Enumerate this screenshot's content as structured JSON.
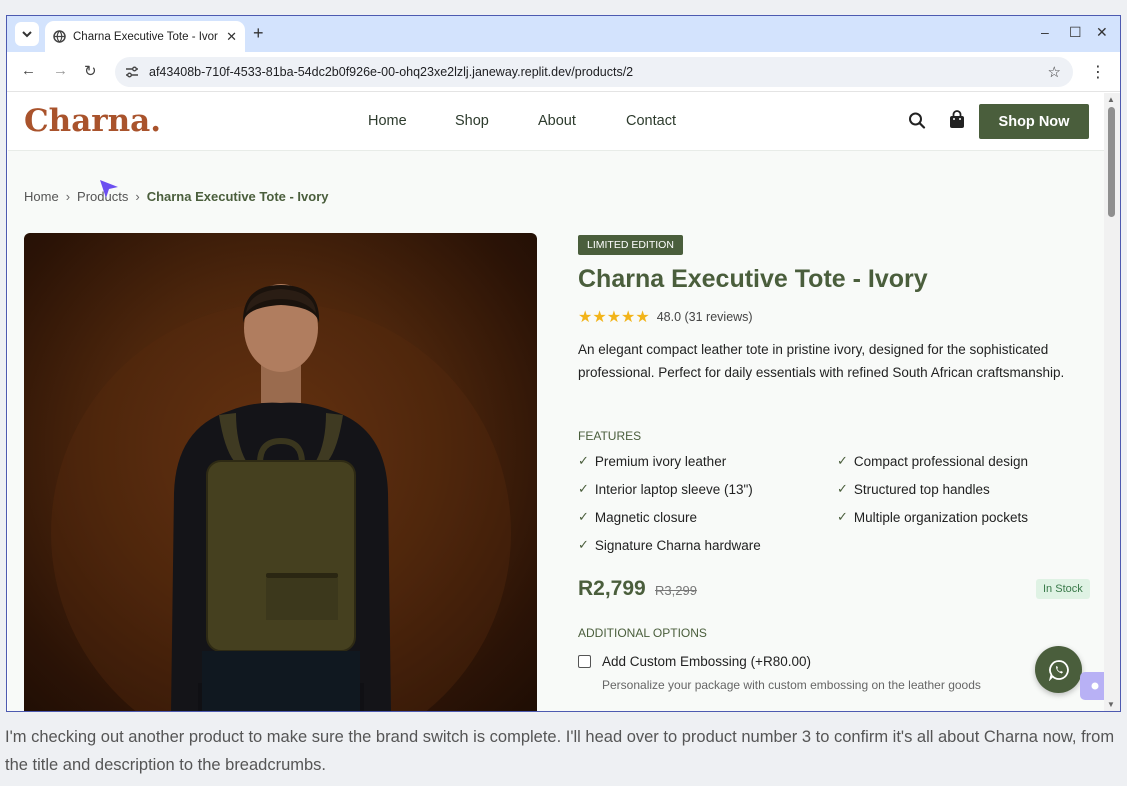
{
  "browser": {
    "tab_title": "Charna Executive Tote - Ivory",
    "tab_close": "✕",
    "new_tab": "+",
    "url": "af43408b-710f-4533-81ba-54dc2b0f926e-00-ohq23xe2lzlj.janeway.replit.dev/products/2",
    "window_controls": {
      "minimize": "–",
      "maximize": "☐",
      "close": "✕"
    }
  },
  "site": {
    "logo": "Charna.",
    "nav": [
      "Home",
      "Shop",
      "About",
      "Contact"
    ],
    "cta": "Shop Now",
    "icons": [
      "search-icon",
      "bag-icon"
    ]
  },
  "breadcrumb": [
    "Home",
    "Products",
    "Charna Executive Tote - Ivory"
  ],
  "product": {
    "badge": "LIMITED EDITION",
    "title": "Charna Executive Tote - Ivory",
    "rating_stars": 5,
    "rating_text": "48.0 (31 reviews)",
    "description": "An elegant compact leather tote in pristine ivory, designed for the sophisticated professional. Perfect for daily essentials with refined South African craftsmanship.",
    "features_label": "FEATURES",
    "features": [
      "Premium ivory leather",
      "Compact professional design",
      "Interior laptop sleeve (13\")",
      "Structured top handles",
      "Magnetic closure",
      "Multiple organization pockets",
      "Signature Charna hardware"
    ],
    "price": "R2,799",
    "old_price": "R3,299",
    "stock": "In Stock",
    "options_label": "ADDITIONAL OPTIONS",
    "option": {
      "label": "Add Custom Embossing (+R80.00)",
      "description": "Personalize your package with custom embossing on the leather goods",
      "checked": false
    }
  },
  "colors": {
    "brand_green": "#4a5e3c",
    "logo_rust": "#a9532c",
    "star": "#f2b41a",
    "stock_bg": "#dff2e4"
  },
  "caption": "I'm checking out another product to make sure the brand switch is complete. I'll head over to product number 3 to confirm it's all about Charna now, from the title and description to the breadcrumbs."
}
